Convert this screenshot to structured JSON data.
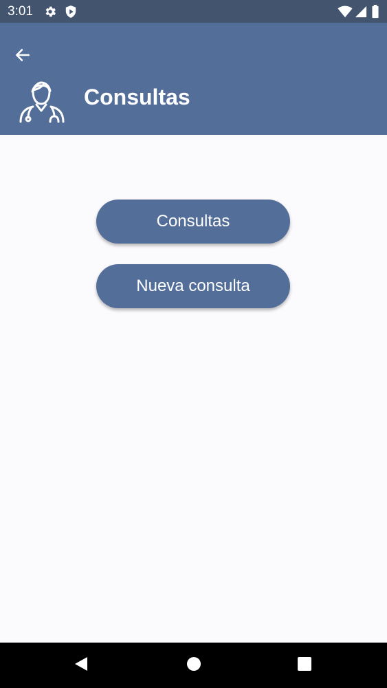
{
  "status_bar": {
    "time": "3:01",
    "icons": [
      "gear-icon",
      "shield-icon",
      "wifi-icon",
      "signal-icon",
      "battery-icon"
    ]
  },
  "app_bar": {
    "title": "Consultas",
    "back_icon": "arrow-left-icon",
    "avatar_icon": "doctor-icon"
  },
  "main": {
    "buttons": [
      {
        "label": "Consultas"
      },
      {
        "label": "Nueva consulta"
      }
    ]
  },
  "nav_bar": {
    "icons": [
      "back-triangle-icon",
      "home-circle-icon",
      "recents-square-icon"
    ]
  },
  "colors": {
    "primary": "#546e9a",
    "status_bar": "#43546f",
    "background": "#fbfafd",
    "text_on_primary": "#ffffff"
  }
}
